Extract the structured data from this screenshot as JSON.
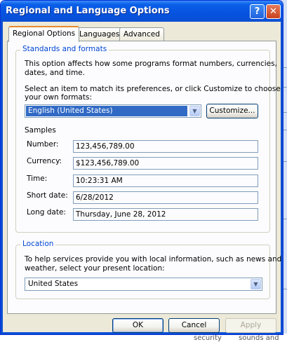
{
  "window": {
    "title": "Regional and Language Options",
    "help_glyph": "?",
    "close_glyph": "✕"
  },
  "tabs": [
    {
      "label": "Regional Options",
      "active": true
    },
    {
      "label": "Languages",
      "active": false
    },
    {
      "label": "Advanced",
      "active": false
    }
  ],
  "standards": {
    "group_label": "Standards and formats",
    "description_line1": "This option affects how some programs format numbers, currencies,",
    "description_line2": "dates, and time.",
    "select_line1": "Select an item to match its preferences, or click Customize to choose",
    "select_line2": "your own formats:",
    "format_value": "English (United States)",
    "customize_label": "Customize...",
    "samples_label": "Samples",
    "samples": [
      {
        "label": "Number:",
        "value": "123,456,789.00"
      },
      {
        "label": "Currency:",
        "value": "$123,456,789.00"
      },
      {
        "label": "Time:",
        "value": "10:23:31 AM"
      },
      {
        "label": "Short date:",
        "value": "6/28/2012"
      },
      {
        "label": "Long date:",
        "value": "Thursday, June 28, 2012"
      }
    ]
  },
  "location": {
    "group_label": "Location",
    "description_line1": "To help services provide you with local information, such as news and",
    "description_line2": "weather, select your present location:",
    "value": "United States"
  },
  "buttons": {
    "ok": "OK",
    "cancel": "Cancel",
    "apply": "Apply"
  },
  "background": {
    "bottom_text_1": "security",
    "bottom_text_2": "sounds and"
  },
  "colors": {
    "titlebar": "#0653e0",
    "group_label": "#0046d5",
    "selection": "#316ac5",
    "tab_highlight": "#e68b2c"
  }
}
